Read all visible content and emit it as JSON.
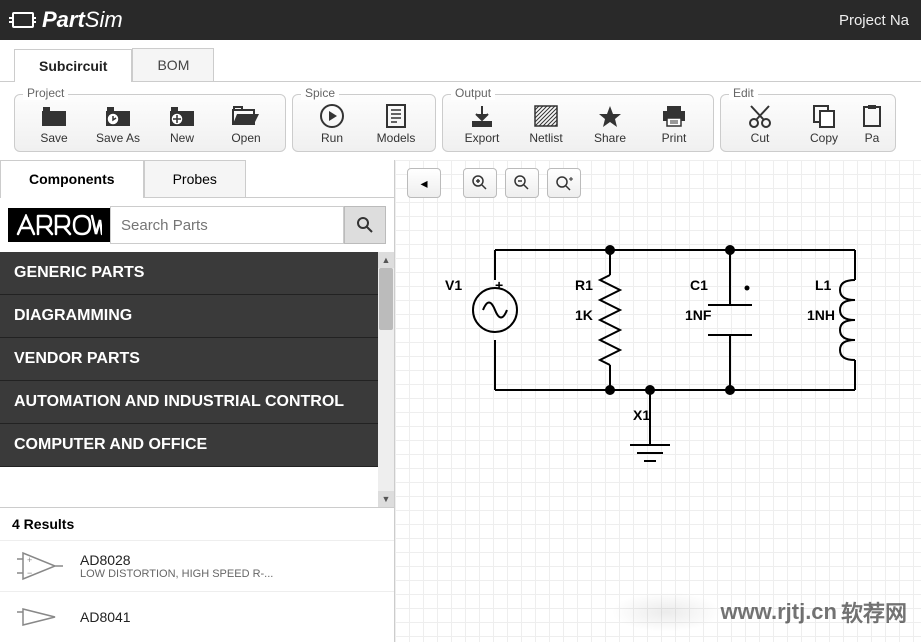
{
  "app": {
    "name_bold": "Part",
    "name_light": "Sim",
    "project_label": "Project Na"
  },
  "tabs": {
    "subcircuit": "Subcircuit",
    "bom": "BOM"
  },
  "toolbar": {
    "groups": {
      "project": "Project",
      "spice": "Spice",
      "output": "Output",
      "edit": "Edit"
    },
    "save": "Save",
    "saveas": "Save As",
    "new": "New",
    "open": "Open",
    "run": "Run",
    "models": "Models",
    "export": "Export",
    "netlist": "Netlist",
    "share": "Share",
    "print": "Print",
    "cut": "Cut",
    "copy": "Copy",
    "paste": "Pa"
  },
  "left": {
    "components": "Components",
    "probes": "Probes",
    "arrow": "ⱭⱤⱤꓳW",
    "search_placeholder": "Search Parts",
    "cats": [
      "GENERIC PARTS",
      "DIAGRAMMING",
      "VENDOR PARTS",
      "AUTOMATION AND INDUSTRIAL CONTROL",
      "COMPUTER AND OFFICE"
    ],
    "results_hdr": "4 Results",
    "results": [
      {
        "name": "AD8028",
        "desc": "LOW DISTORTION, HIGH SPEED R-..."
      },
      {
        "name": "AD8041",
        "desc": ""
      }
    ]
  },
  "circuit": {
    "v1": "V1",
    "r1": "R1",
    "r1v": "1K",
    "c1": "C1",
    "c1v": "1NF",
    "l1": "L1",
    "l1v": "1NH",
    "x1": "X1"
  },
  "watermark": {
    "url": "www.rjtj.cn",
    "cn": "软荐网"
  }
}
